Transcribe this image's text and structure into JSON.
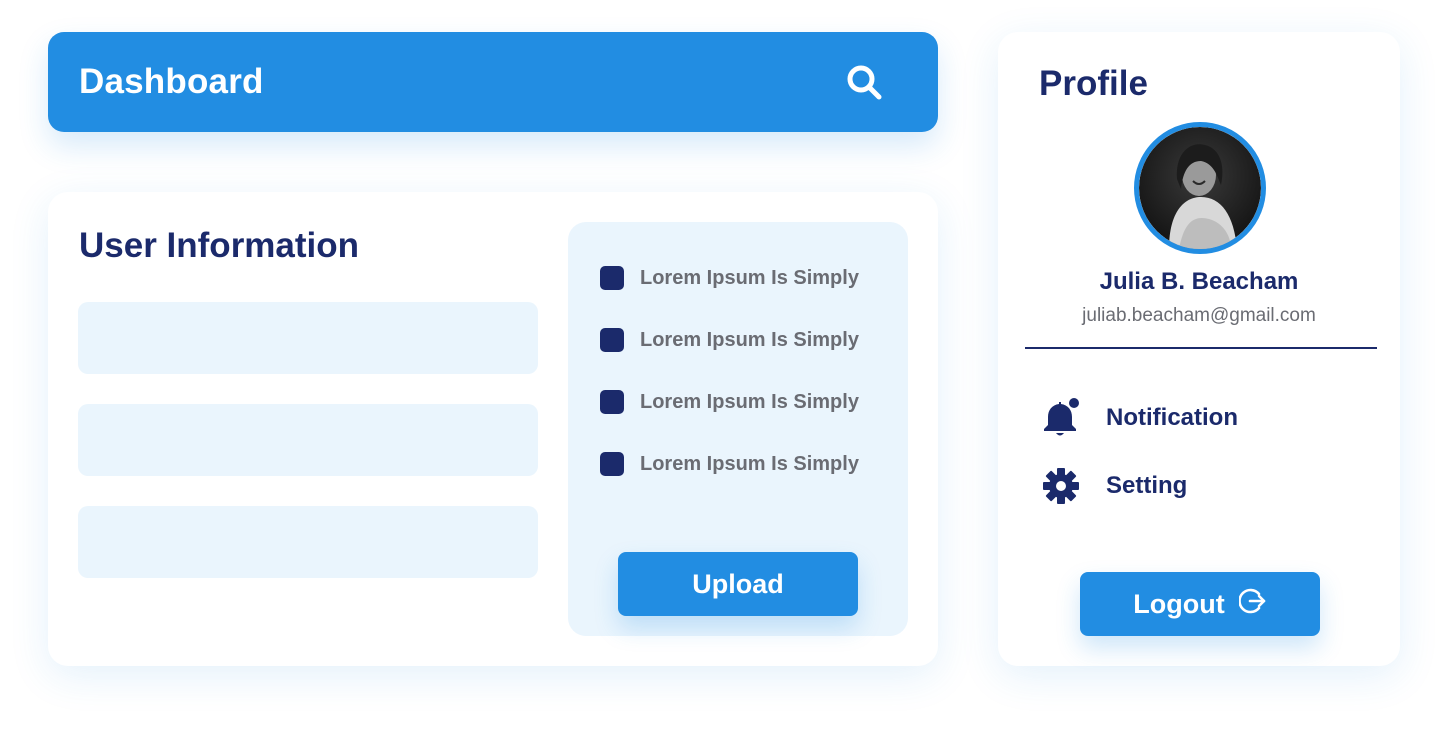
{
  "header": {
    "title": "Dashboard",
    "search_icon": "search-icon"
  },
  "user_info": {
    "title": "User Information",
    "fields": [
      {
        "value": "",
        "placeholder": ""
      },
      {
        "value": "",
        "placeholder": ""
      },
      {
        "value": "",
        "placeholder": ""
      }
    ],
    "checklist": [
      {
        "label": "Lorem Ipsum Is Simply",
        "checked": true
      },
      {
        "label": "Lorem Ipsum Is Simply",
        "checked": true
      },
      {
        "label": "Lorem Ipsum Is Simply",
        "checked": true
      },
      {
        "label": "Lorem Ipsum Is Simply",
        "checked": true
      }
    ],
    "upload_label": "Upload"
  },
  "profile": {
    "title": "Profile",
    "name": "Julia B. Beacham",
    "email": "juliab.beacham@gmail.com",
    "menu": [
      {
        "label": "Notification",
        "icon": "bell-icon",
        "has_dot": true
      },
      {
        "label": "Setting",
        "icon": "gear-icon"
      }
    ],
    "logout_label": "Logout",
    "logout_icon": "logout-icon"
  },
  "colors": {
    "primary": "#228de2",
    "navy": "#1b2a6b",
    "light_panel": "#eaf5fd",
    "muted_text": "#6a6c73"
  }
}
